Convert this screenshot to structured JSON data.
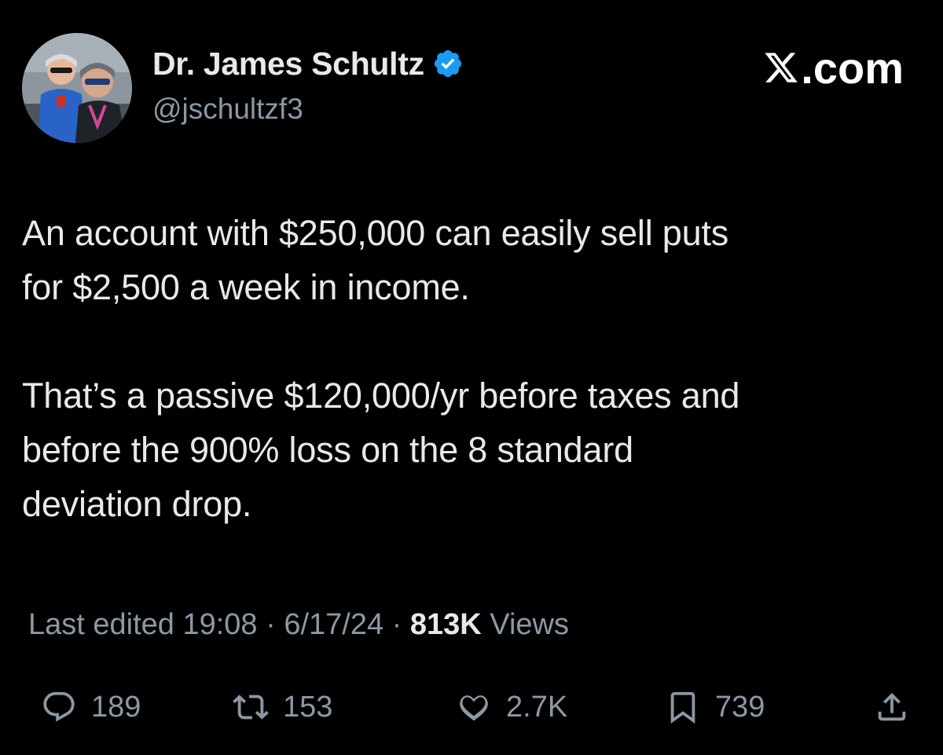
{
  "author": {
    "display_name": "Dr. James Schultz",
    "handle": "@jschultzf3",
    "verified": true
  },
  "brand": {
    "label": ".com",
    "icon": "x-logo-icon"
  },
  "tweet": {
    "paragraphs": [
      "An account with $250,000 can easily sell puts\nfor $2,500 a week in income.",
      "That’s a passive $120,000/yr before taxes and\nbefore the 900% loss on the 8 standard\ndeviation drop."
    ]
  },
  "meta": {
    "edited_prefix": "Last edited 19:08 · 6/17/24",
    "separator": " · ",
    "views_count": "813K",
    "views_label": " Views"
  },
  "actions": {
    "replies": {
      "icon": "reply-icon",
      "count": "189"
    },
    "reposts": {
      "icon": "repost-icon",
      "count": "153"
    },
    "likes": {
      "icon": "heart-icon",
      "count": "2.7K"
    },
    "bookmarks": {
      "icon": "bookmark-icon",
      "count": "739"
    },
    "share": {
      "icon": "share-icon"
    }
  },
  "colors": {
    "background": "#000000",
    "text": "#e7e9ea",
    "secondary": "#8b98a5",
    "verified": "#1d9bf0"
  }
}
